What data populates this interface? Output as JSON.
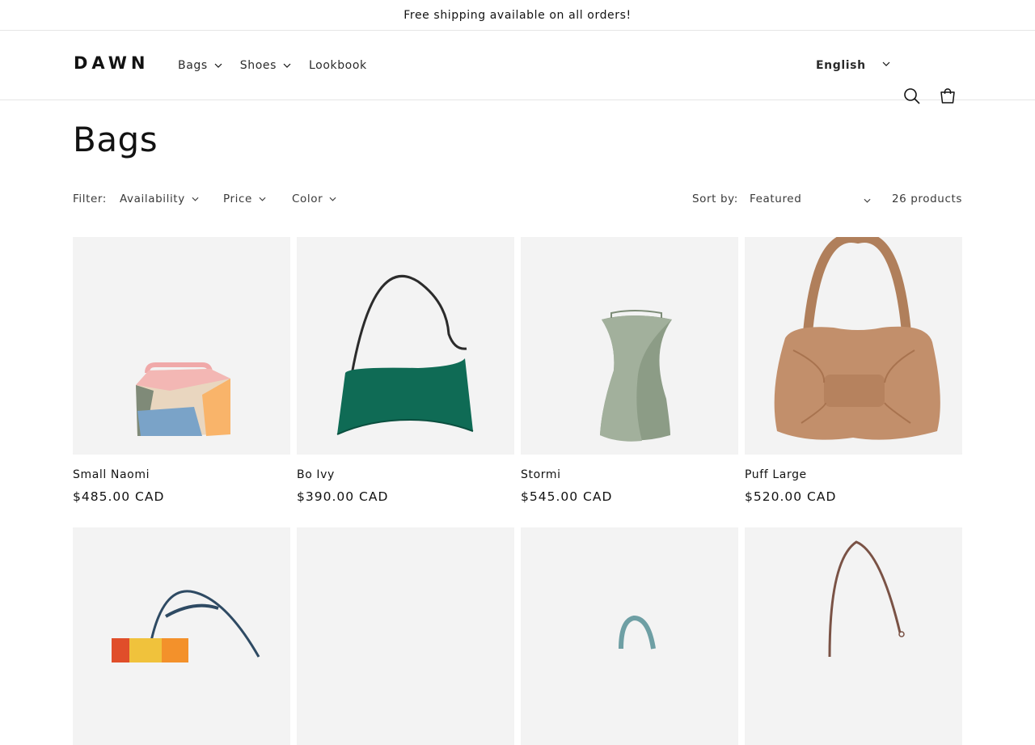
{
  "announcement": "Free shipping available on all orders!",
  "header": {
    "logo": "DAWN",
    "nav": [
      {
        "label": "Bags",
        "has_dropdown": true
      },
      {
        "label": "Shoes",
        "has_dropdown": true
      },
      {
        "label": "Lookbook",
        "has_dropdown": false
      }
    ],
    "language": "English",
    "icons": [
      "search-icon",
      "cart-icon"
    ]
  },
  "collection": {
    "title": "Bags",
    "filter_label": "Filter:",
    "filters": [
      "Availability",
      "Price",
      "Color"
    ],
    "sort_label": "Sort by:",
    "sort_value": "Featured",
    "count": "26 products"
  },
  "products": [
    {
      "title": "Small Naomi",
      "price": "$485.00 CAD"
    },
    {
      "title": "Bo Ivy",
      "price": "$390.00 CAD"
    },
    {
      "title": "Stormi",
      "price": "$545.00 CAD"
    },
    {
      "title": "Puff Large",
      "price": "$520.00 CAD"
    },
    {
      "title": "",
      "price": ""
    },
    {
      "title": "",
      "price": ""
    },
    {
      "title": "",
      "price": ""
    },
    {
      "title": "",
      "price": ""
    }
  ],
  "colors": {
    "text": "#121212",
    "border": "#e6e6e6",
    "card_bg": "#f3f3f3"
  }
}
